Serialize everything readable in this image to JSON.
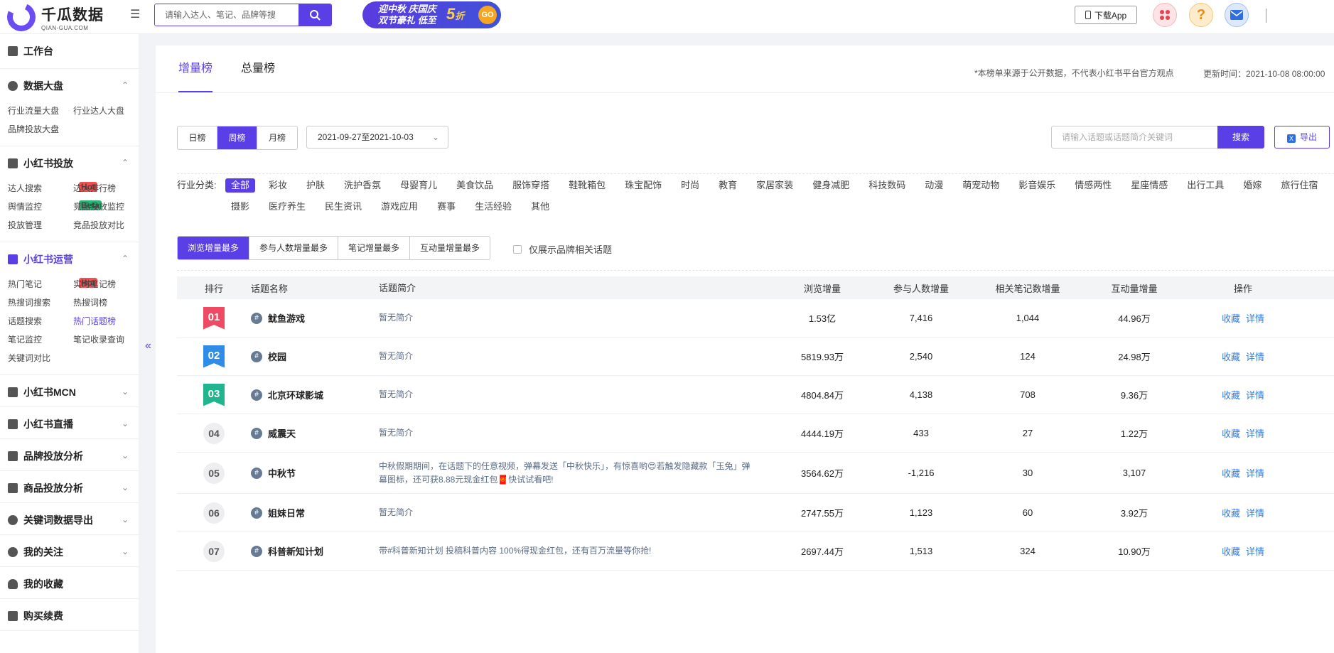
{
  "header": {
    "logo_cn": "千瓜数据",
    "logo_en": "QIAN-GUA.COM",
    "search_placeholder": "请输入达人、笔记、品牌等搜",
    "banner_line1": "迎中秋 庆国庆",
    "banner_line2": "双节豪礼 低至",
    "banner_five": "5",
    "banner_zhe": "折",
    "banner_go": "GO",
    "download_label": "下载App"
  },
  "sidebar": {
    "workbench": "工作台",
    "sections": [
      {
        "title": "数据大盘",
        "items": [
          "行业流量大盘",
          "行业达人大盘",
          "品牌投放大盘"
        ]
      },
      {
        "title": "小红书投放",
        "items": [
          "达人搜索",
          "达人排行榜",
          "舆情监控",
          "竞品投放监控",
          "投放管理",
          "竞品投放对比"
        ]
      },
      {
        "title": "小红书运营",
        "items": [
          "热门笔记",
          "实时笔记榜",
          "热搜词搜索",
          "热搜词榜",
          "话题搜索",
          "热门话题榜",
          "笔记监控",
          "笔记收录查询",
          "关键词对比"
        ]
      }
    ],
    "collapsed": [
      "小红书MCN",
      "小红书直播",
      "品牌投放分析",
      "商品投放分析",
      "关键词数据导出",
      "我的关注",
      "我的收藏",
      "购买续费"
    ],
    "tag_hot": "Hot",
    "tag_beta": "Beta"
  },
  "main": {
    "tabs": [
      "增量榜",
      "总量榜"
    ],
    "notice": "*本榜单来源于公开数据，不代表小红书平台官方观点",
    "updated": "更新时间：2021-10-08 08:00:00",
    "period": [
      "日榜",
      "周榜",
      "月榜"
    ],
    "date_range": "2021-09-27至2021-10-03",
    "kw_placeholder": "请输入话题或话题简介关键词",
    "search_btn": "搜索",
    "export_btn": "导出",
    "industry_label": "行业分类:",
    "industries": [
      "全部",
      "彩妆",
      "护肤",
      "洗护香氛",
      "母婴育儿",
      "美食饮品",
      "服饰穿搭",
      "鞋靴箱包",
      "珠宝配饰",
      "时尚",
      "教育",
      "家居家装",
      "健身减肥",
      "科技数码",
      "动漫",
      "萌宠动物",
      "影音娱乐",
      "情感两性",
      "星座情感",
      "出行工具",
      "婚嫁",
      "旅行住宿",
      "摄影",
      "医疗养生",
      "民生资讯",
      "游戏应用",
      "赛事",
      "生活经验",
      "其他"
    ],
    "sorts": [
      "浏览增量最多",
      "参与人数增量最多",
      "笔记增量最多",
      "互动量增量最多"
    ],
    "brand_only": "仅展示品牌相关话题",
    "columns": [
      "排行",
      "话题名称",
      "话题简介",
      "浏览增量",
      "参与人数增量",
      "相关笔记数增量",
      "互动量增量",
      "操作"
    ],
    "op_fav": "收藏",
    "op_detail": "详情",
    "rows": [
      {
        "rank": "01",
        "name": "鱿鱼游戏",
        "desc": "暂无简介",
        "views": "1.53亿",
        "people": "7,416",
        "notes": "1,044",
        "inter": "44.96万"
      },
      {
        "rank": "02",
        "name": "校园",
        "desc": "暂无简介",
        "views": "5819.93万",
        "people": "2,540",
        "notes": "124",
        "inter": "24.98万"
      },
      {
        "rank": "03",
        "name": "北京环球影城",
        "desc": "暂无简介",
        "views": "4804.84万",
        "people": "4,138",
        "notes": "708",
        "inter": "9.36万"
      },
      {
        "rank": "04",
        "name": "威震天",
        "desc": "暂无简介",
        "views": "4444.19万",
        "people": "433",
        "notes": "27",
        "inter": "1.22万"
      },
      {
        "rank": "05",
        "name": "中秋节",
        "desc": "中秋假期期间，在话题下的任意视频，弹幕发送「中秋快乐」，有惊喜哟😍若触发隐藏款「玉兔」弹幕图标，还可获8.88元现金红包🧧快试试看吧!",
        "views": "3564.62万",
        "people": "-1,216",
        "notes": "30",
        "inter": "3,107"
      },
      {
        "rank": "06",
        "name": "姐妹日常",
        "desc": "暂无简介",
        "views": "2747.55万",
        "people": "1,123",
        "notes": "60",
        "inter": "3.92万"
      },
      {
        "rank": "07",
        "name": "科普新知计划",
        "desc": "带#科普新知计划 投稿科普内容 100%得现金红包，还有百万流量等你抢!",
        "views": "2697.44万",
        "people": "1,513",
        "notes": "324",
        "inter": "10.90万"
      }
    ]
  }
}
